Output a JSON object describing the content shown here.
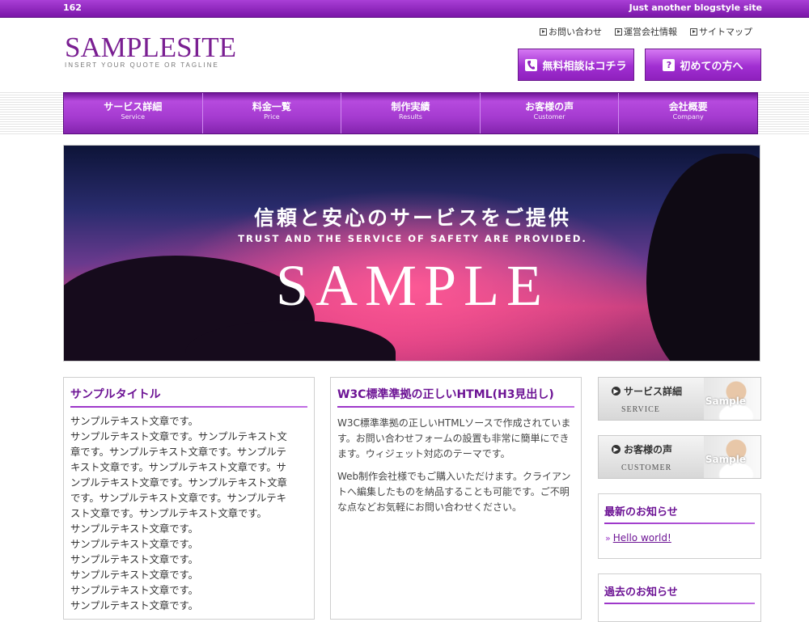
{
  "topbar": {
    "left_text": "162",
    "right_text": "Just another blogstyle site"
  },
  "logo": {
    "name": "SAMPLESITE",
    "tagline": "INSERT YOUR QUOTE OR TAGLINE"
  },
  "header_links": [
    {
      "label": "お問い合わせ",
      "icon": "play-square-icon"
    },
    {
      "label": "運営会社情報",
      "icon": "play-square-icon"
    },
    {
      "label": "サイトマップ",
      "icon": "play-square-icon"
    }
  ],
  "cta_buttons": [
    {
      "label": "無料相談はコチラ",
      "icon": "phone-icon"
    },
    {
      "label": "初めての方へ",
      "icon": "question-icon",
      "icon_glyph": "?"
    }
  ],
  "nav": [
    {
      "jp": "サービス詳細",
      "en": "Service"
    },
    {
      "jp": "料金一覧",
      "en": "Price"
    },
    {
      "jp": "制作実績",
      "en": "Results"
    },
    {
      "jp": "お客様の声",
      "en": "Customer"
    },
    {
      "jp": "会社概要",
      "en": "Company"
    }
  ],
  "hero": {
    "headline": "信頼と安心のサービスをご提供",
    "subline": "TRUST AND THE SERVICE OF SAFETY ARE PROVIDED.",
    "big": "SAMPLE"
  },
  "col1": {
    "title": "サンプルタイトル",
    "lines": [
      "サンプルテキスト文章です。",
      "サンプルテキスト文章です。サンプルテキスト文",
      "章です。サンプルテキスト文章です。サンプルテ",
      "キスト文章です。サンプルテキスト文章です。サ",
      "ンプルテキスト文章です。サンプルテキスト文章",
      "です。サンプルテキスト文章です。サンプルテキ",
      "スト文章です。サンプルテキスト文章です。",
      "サンプルテキスト文章です。",
      "サンプルテキスト文章です。",
      "サンプルテキスト文章です。",
      "サンプルテキスト文章です。",
      "サンプルテキスト文章です。",
      "サンプルテキスト文章です。"
    ]
  },
  "col2": {
    "title": "W3C標準準拠の正しいHTML(H3見出し)",
    "p1": "W3C標準準拠の正しいHTMLソースで作成されています。お問い合わせフォームの設置も非常に簡単にできます。ウィジェット対応のテーマです。",
    "p2": "Web制作会社様でもご購入いただけます。クライアントへ編集したものを納品することも可能です。ご不明な点などお気軽にお問い合わせください。"
  },
  "banners": [
    {
      "title": "サービス詳細",
      "en": "SERVICE",
      "photo_label": "Sample"
    },
    {
      "title": "お客様の声",
      "en": "CUSTOMER",
      "photo_label": "Sample"
    }
  ],
  "news": {
    "title": "最新のお知らせ",
    "link": "Hello world!"
  },
  "past_news": {
    "title": "過去のお知らせ"
  },
  "colors": {
    "accent": "#9b34c8",
    "accent_dark": "#6d1495"
  }
}
